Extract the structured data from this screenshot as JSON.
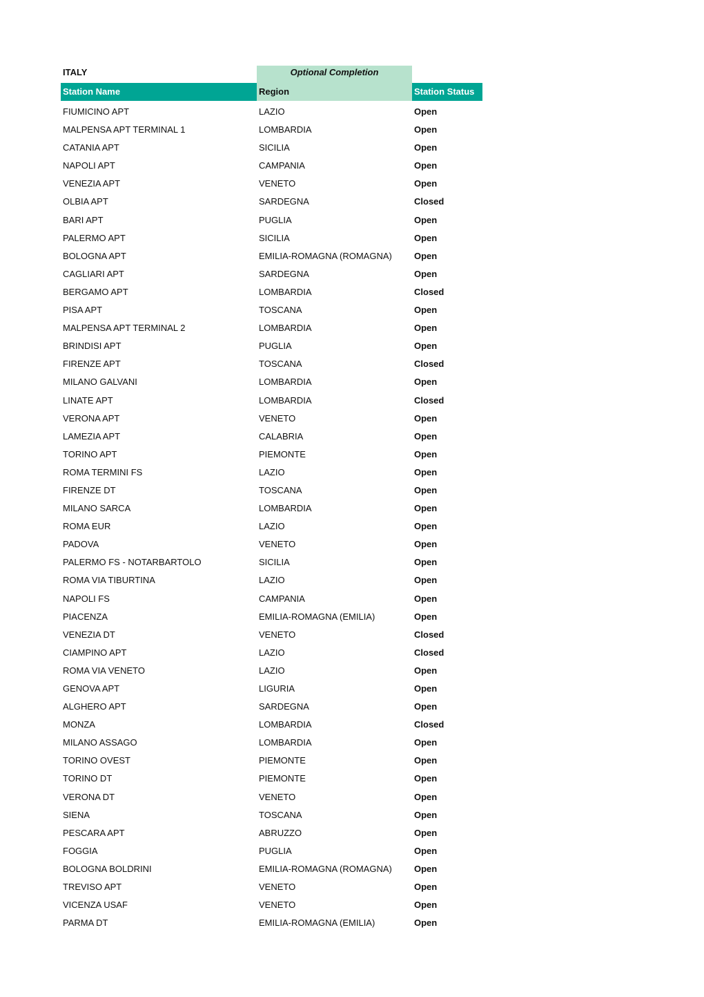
{
  "sheet": {
    "country": "ITALY",
    "optional_label": "Optional Completion",
    "colors": {
      "header_teal": "#00a594",
      "optional_green": "#b7e2cd"
    },
    "columns": {
      "name": "Station Name",
      "region": "Region",
      "status": "Station Status"
    },
    "rows": [
      {
        "name": "FIUMICINO APT",
        "region": "LAZIO",
        "status": "Open"
      },
      {
        "name": "MALPENSA APT TERMINAL 1",
        "region": "LOMBARDIA",
        "status": "Open"
      },
      {
        "name": "CATANIA APT",
        "region": "SICILIA",
        "status": "Open"
      },
      {
        "name": "NAPOLI APT",
        "region": "CAMPANIA",
        "status": "Open"
      },
      {
        "name": "VENEZIA APT",
        "region": "VENETO",
        "status": "Open"
      },
      {
        "name": "OLBIA APT",
        "region": "SARDEGNA",
        "status": "Closed"
      },
      {
        "name": "BARI APT",
        "region": "PUGLIA",
        "status": "Open"
      },
      {
        "name": "PALERMO APT",
        "region": "SICILIA",
        "status": "Open"
      },
      {
        "name": "BOLOGNA APT",
        "region": "EMILIA-ROMAGNA (ROMAGNA)",
        "status": "Open"
      },
      {
        "name": "CAGLIARI APT",
        "region": "SARDEGNA",
        "status": "Open"
      },
      {
        "name": "BERGAMO APT",
        "region": "LOMBARDIA",
        "status": "Closed"
      },
      {
        "name": "PISA APT",
        "region": "TOSCANA",
        "status": "Open"
      },
      {
        "name": "MALPENSA APT TERMINAL 2",
        "region": "LOMBARDIA",
        "status": "Open"
      },
      {
        "name": "BRINDISI APT",
        "region": "PUGLIA",
        "status": "Open"
      },
      {
        "name": "FIRENZE APT",
        "region": "TOSCANA",
        "status": "Closed"
      },
      {
        "name": "MILANO GALVANI",
        "region": "LOMBARDIA",
        "status": "Open"
      },
      {
        "name": "LINATE APT",
        "region": "LOMBARDIA",
        "status": "Closed"
      },
      {
        "name": "VERONA APT",
        "region": "VENETO",
        "status": "Open"
      },
      {
        "name": "LAMEZIA APT",
        "region": "CALABRIA",
        "status": "Open"
      },
      {
        "name": "TORINO APT",
        "region": "PIEMONTE",
        "status": "Open"
      },
      {
        "name": "ROMA TERMINI FS",
        "region": "LAZIO",
        "status": "Open"
      },
      {
        "name": "FIRENZE DT",
        "region": "TOSCANA",
        "status": "Open"
      },
      {
        "name": "MILANO SARCA",
        "region": "LOMBARDIA",
        "status": "Open"
      },
      {
        "name": "ROMA EUR",
        "region": "LAZIO",
        "status": "Open"
      },
      {
        "name": "PADOVA",
        "region": "VENETO",
        "status": "Open"
      },
      {
        "name": "PALERMO FS - NOTARBARTOLO",
        "region": "SICILIA",
        "status": "Open"
      },
      {
        "name": "ROMA VIA TIBURTINA",
        "region": "LAZIO",
        "status": "Open"
      },
      {
        "name": "NAPOLI FS",
        "region": "CAMPANIA",
        "status": "Open"
      },
      {
        "name": "PIACENZA",
        "region": "EMILIA-ROMAGNA (EMILIA)",
        "status": "Open"
      },
      {
        "name": "VENEZIA DT",
        "region": "VENETO",
        "status": "Closed"
      },
      {
        "name": "CIAMPINO APT",
        "region": "LAZIO",
        "status": "Closed"
      },
      {
        "name": "ROMA VIA VENETO",
        "region": "LAZIO",
        "status": "Open"
      },
      {
        "name": "GENOVA APT",
        "region": "LIGURIA",
        "status": "Open"
      },
      {
        "name": "ALGHERO APT",
        "region": "SARDEGNA",
        "status": "Open"
      },
      {
        "name": "MONZA",
        "region": "LOMBARDIA",
        "status": "Closed"
      },
      {
        "name": "MILANO ASSAGO",
        "region": "LOMBARDIA",
        "status": "Open"
      },
      {
        "name": "TORINO OVEST",
        "region": "PIEMONTE",
        "status": "Open"
      },
      {
        "name": "TORINO DT",
        "region": "PIEMONTE",
        "status": "Open"
      },
      {
        "name": "VERONA DT",
        "region": "VENETO",
        "status": "Open"
      },
      {
        "name": "SIENA",
        "region": "TOSCANA",
        "status": "Open"
      },
      {
        "name": "PESCARA APT",
        "region": "ABRUZZO",
        "status": "Open"
      },
      {
        "name": "FOGGIA",
        "region": "PUGLIA",
        "status": "Open"
      },
      {
        "name": "BOLOGNA BOLDRINI",
        "region": "EMILIA-ROMAGNA (ROMAGNA)",
        "status": "Open"
      },
      {
        "name": "TREVISO APT",
        "region": "VENETO",
        "status": "Open"
      },
      {
        "name": "VICENZA USAF",
        "region": "VENETO",
        "status": "Open"
      },
      {
        "name": "PARMA DT",
        "region": "EMILIA-ROMAGNA (EMILIA)",
        "status": "Open"
      }
    ]
  }
}
